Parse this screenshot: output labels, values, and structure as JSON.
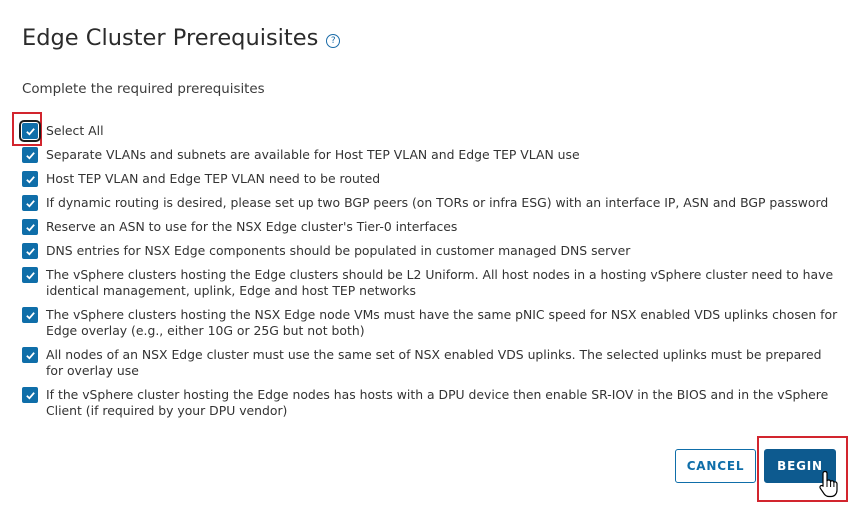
{
  "dialog": {
    "title": "Edge Cluster Prerequisites",
    "help_icon": "question-circle-icon",
    "subtitle": "Complete the required prerequisites"
  },
  "checklist": {
    "select_all": {
      "label": "Select All",
      "checked": true
    },
    "items": [
      {
        "label": "Separate VLANs and subnets are available for Host TEP VLAN and Edge TEP VLAN use",
        "checked": true
      },
      {
        "label": "Host TEP VLAN and Edge TEP VLAN need to be routed",
        "checked": true
      },
      {
        "label": "If dynamic routing is desired, please set up two BGP peers (on TORs or infra ESG) with an interface IP, ASN and BGP password",
        "checked": true
      },
      {
        "label": "Reserve an ASN to use for the NSX Edge cluster's Tier-0 interfaces",
        "checked": true
      },
      {
        "label": "DNS entries for NSX Edge components should be populated in customer managed DNS server",
        "checked": true
      },
      {
        "label": "The vSphere clusters hosting the Edge clusters should be L2 Uniform. All host nodes in a hosting vSphere cluster need to have identical management, uplink, Edge and host TEP networks",
        "checked": true
      },
      {
        "label": "The vSphere clusters hosting the NSX Edge node VMs must have the same pNIC speed for NSX enabled VDS uplinks chosen for Edge overlay (e.g., either 10G or 25G but not both)",
        "checked": true
      },
      {
        "label": "All nodes of an NSX Edge cluster must use the same set of NSX enabled VDS uplinks. The selected uplinks must be prepared for overlay use",
        "checked": true
      },
      {
        "label": "If the vSphere cluster hosting the Edge nodes has hosts with a DPU device then enable SR-IOV in the BIOS and in the vSphere Client (if required by your DPU vendor)",
        "checked": true
      }
    ]
  },
  "footer": {
    "cancel_label": "CANCEL",
    "begin_label": "BEGIN"
  },
  "colors": {
    "accent": "#0f6ea9",
    "primary_button": "#0d5a8f",
    "highlight": "#d2252e"
  }
}
